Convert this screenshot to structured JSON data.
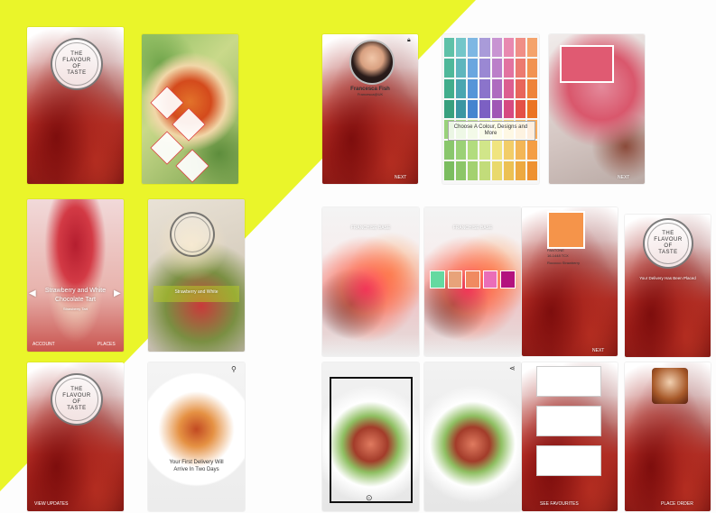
{
  "colors": {
    "yellow": "#eaf52a",
    "palette": [
      "#5ec1a8",
      "#73c6c9",
      "#7eb7e3",
      "#a99bd9",
      "#c894d2",
      "#e889b0",
      "#f08e86",
      "#f4a36b",
      "#4fb89a",
      "#5fb6bd",
      "#6aa6df",
      "#9a88d3",
      "#bb7fc9",
      "#e273a0",
      "#ec7a70",
      "#f19352",
      "#41ad8c",
      "#4aa6b0",
      "#5695d8",
      "#8b74cb",
      "#ae6bbf",
      "#dc5e90",
      "#e8655b",
      "#ee833a",
      "#38a07e",
      "#3b96a2",
      "#4584cf",
      "#7c60c3",
      "#a057b5",
      "#d64a81",
      "#e45047",
      "#eb7322",
      "#99d27a",
      "#aadd84",
      "#c1e68c",
      "#dff097",
      "#f6ef92",
      "#f8d97b",
      "#f9c26a",
      "#f9ab5a",
      "#8ac76c",
      "#9bd176",
      "#b2dc7e",
      "#d1e689",
      "#f0e47f",
      "#f2cd68",
      "#f3b656",
      "#f49e45",
      "#7bbd5f",
      "#8cc668",
      "#a3d170",
      "#c2dc7a",
      "#e9d96c",
      "#ecc154",
      "#eda941",
      "#ee9131"
    ],
    "swatches": [
      "#64d9a0",
      "#e8a37a",
      "#f08a60",
      "#ea6db8",
      "#b3127e"
    ]
  },
  "screens": {
    "logo_line1": "THE",
    "logo_line2": "FLAVOUR",
    "logo_line3": "OF",
    "logo_line4": "TASTE",
    "dish_title_1": "Strawberry and White",
    "dish_title_2": "Chocolate Tart",
    "dish_sub": "Strawberry Tart",
    "back_label": "ACCOUNT",
    "next_label": "PLACES",
    "profile_name": "Francesca Fish",
    "profile_sub": "Francesca@UK",
    "palette_caption": "Choose A Colour, Designs and More",
    "palette_caption_2": "Choose A Colour",
    "pantone_label": "PANTONE",
    "pantone_code": "16-1448 TCX",
    "pantone_name": "Rococco Strawberry",
    "delivery_line1": "Your First Delivery Will",
    "delivery_line2": "Arrive In Two Days",
    "view_update": "VIEW UPDATES",
    "next": "NEXT",
    "see_favourites": "SEE FAVOURITES",
    "place_order": "PLACE ORDER",
    "order_summary": "Your Delivery Has Been Placed",
    "franchise": "FRANCHISE BASE"
  }
}
